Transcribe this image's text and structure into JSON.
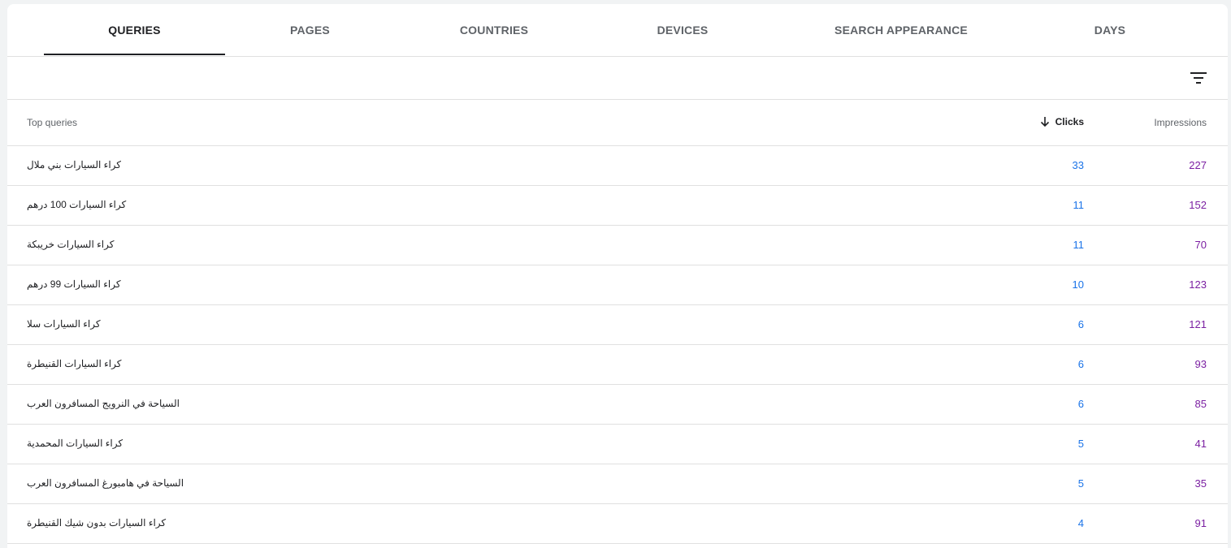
{
  "tabs": [
    {
      "label": "QUERIES",
      "active": true
    },
    {
      "label": "PAGES",
      "active": false
    },
    {
      "label": "COUNTRIES",
      "active": false
    },
    {
      "label": "DEVICES",
      "active": false
    },
    {
      "label": "SEARCH APPEARANCE",
      "active": false
    },
    {
      "label": "DAYS",
      "active": false
    }
  ],
  "toolbar": {
    "filter_icon": "filter-list-icon"
  },
  "table": {
    "headers": {
      "query": "Top queries",
      "clicks": "Clicks",
      "impressions": "Impressions"
    },
    "sort_icon": "arrow-down-icon",
    "rows": [
      {
        "query": "كراء السيارات بني ملال",
        "clicks": "33",
        "impressions": "227"
      },
      {
        "query": "كراء السيارات 100 درهم",
        "clicks": "11",
        "impressions": "152"
      },
      {
        "query": "كراء السيارات خريبكة",
        "clicks": "11",
        "impressions": "70"
      },
      {
        "query": "كراء السيارات 99 درهم",
        "clicks": "10",
        "impressions": "123"
      },
      {
        "query": "كراء السيارات سلا",
        "clicks": "6",
        "impressions": "121"
      },
      {
        "query": "كراء السيارات القنيطرة",
        "clicks": "6",
        "impressions": "93"
      },
      {
        "query": "السياحة في النرويج المسافرون العرب",
        "clicks": "6",
        "impressions": "85"
      },
      {
        "query": "كراء السيارات المحمدية",
        "clicks": "5",
        "impressions": "41"
      },
      {
        "query": "السياحة في هامبورغ المسافرون العرب",
        "clicks": "5",
        "impressions": "35"
      },
      {
        "query": "كراء السيارات بدون شيك القنيطرة",
        "clicks": "4",
        "impressions": "91"
      }
    ]
  },
  "colors": {
    "clicks": "#1a73e8",
    "impressions": "#7b1fa2",
    "active_tab": "#202124"
  }
}
